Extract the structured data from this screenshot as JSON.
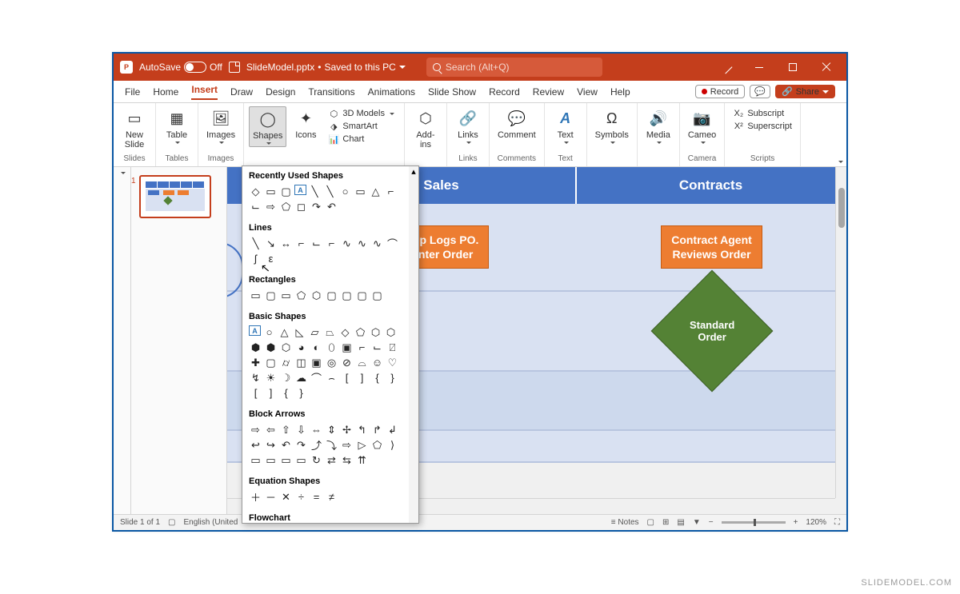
{
  "titlebar": {
    "autosave_label": "AutoSave",
    "autosave_state": "Off",
    "filename": "SlideModel.pptx",
    "save_status": "Saved to this PC",
    "search_placeholder": "Search (Alt+Q)"
  },
  "tabs": {
    "items": [
      "File",
      "Home",
      "Insert",
      "Draw",
      "Design",
      "Transitions",
      "Animations",
      "Slide Show",
      "Record",
      "Review",
      "View",
      "Help"
    ],
    "active": "Insert",
    "record_btn": "Record",
    "share_btn": "Share"
  },
  "ribbon": {
    "groups": {
      "slides": {
        "label": "Slides",
        "new_slide": "New\nSlide"
      },
      "tables": {
        "label": "Tables",
        "table": "Table"
      },
      "images": {
        "label": "Images",
        "images": "Images"
      },
      "illustrations": {
        "shapes": "Shapes",
        "icons": "Icons",
        "models": "3D Models",
        "smartart": "SmartArt",
        "chart": "Chart"
      },
      "addins": {
        "label": "Add-ins",
        "btn": "Add-\nins"
      },
      "links": {
        "label": "Links",
        "btn": "Links"
      },
      "comments": {
        "label": "Comments",
        "btn": "Comment"
      },
      "text": {
        "label": "Text",
        "btn": "Text"
      },
      "symbols": {
        "btn": "Symbols"
      },
      "media": {
        "btn": "Media"
      },
      "cameo": {
        "label": "Camera",
        "btn": "Cameo"
      },
      "scripts": {
        "label": "Scripts",
        "sub": "Subscript",
        "sup": "Superscript"
      }
    }
  },
  "shapes_menu": {
    "sections": {
      "recent": "Recently Used Shapes",
      "lines": "Lines",
      "rectangles": "Rectangles",
      "basic": "Basic Shapes",
      "arrows": "Block Arrows",
      "equation": "Equation Shapes",
      "flowchart": "Flowchart"
    }
  },
  "slide": {
    "thumb_index": "1",
    "columns": {
      "sales": "Sales",
      "contracts": "Contracts"
    },
    "box_sales_line1": "Rep Logs PO.",
    "box_sales_line2": "Enter Order",
    "box_contracts_line1": "Contract Agent",
    "box_contracts_line2": "Reviews Order",
    "diamond_line1": "Standard",
    "diamond_line2": "Order"
  },
  "statusbar": {
    "slide": "Slide 1 of 1",
    "lang": "English (United",
    "notes": "Notes",
    "zoom": "120%"
  },
  "watermark": "SLIDEMODEL.COM"
}
